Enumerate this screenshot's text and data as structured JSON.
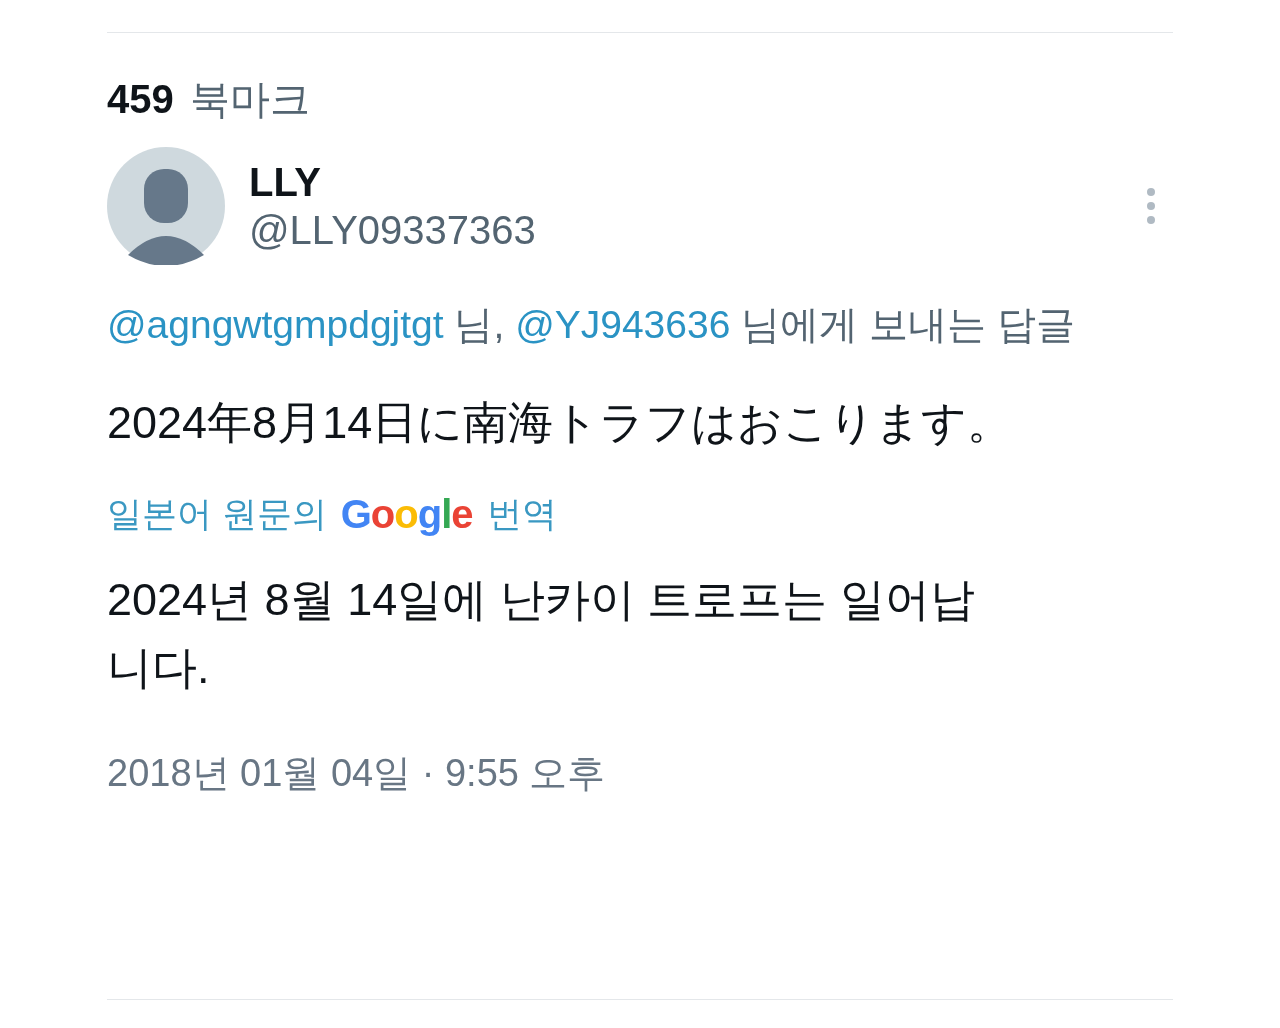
{
  "bookmarks": {
    "count": "459",
    "label": "북마크"
  },
  "author": {
    "name": "LLY",
    "handle": "@LLY09337363"
  },
  "reply_to": [
    {
      "kind": "mention",
      "text": "@agngwtgmpdgjtgt"
    },
    {
      "kind": "text",
      "text": " 님, "
    },
    {
      "kind": "mention",
      "text": "@YJ943636"
    },
    {
      "kind": "text",
      "text": " 님에게 보내는 답글"
    }
  ],
  "tweet_text": "2024年8月14日に南海トラフはおこります。",
  "translation": {
    "prefix": "일본어 원문의",
    "brand": "Google",
    "suffix": "번역",
    "text": "2024년 8월 14일에 난카이 트로프는 일어납니다."
  },
  "timestamp": "2018년 01월 04일 · 9:55 오후"
}
